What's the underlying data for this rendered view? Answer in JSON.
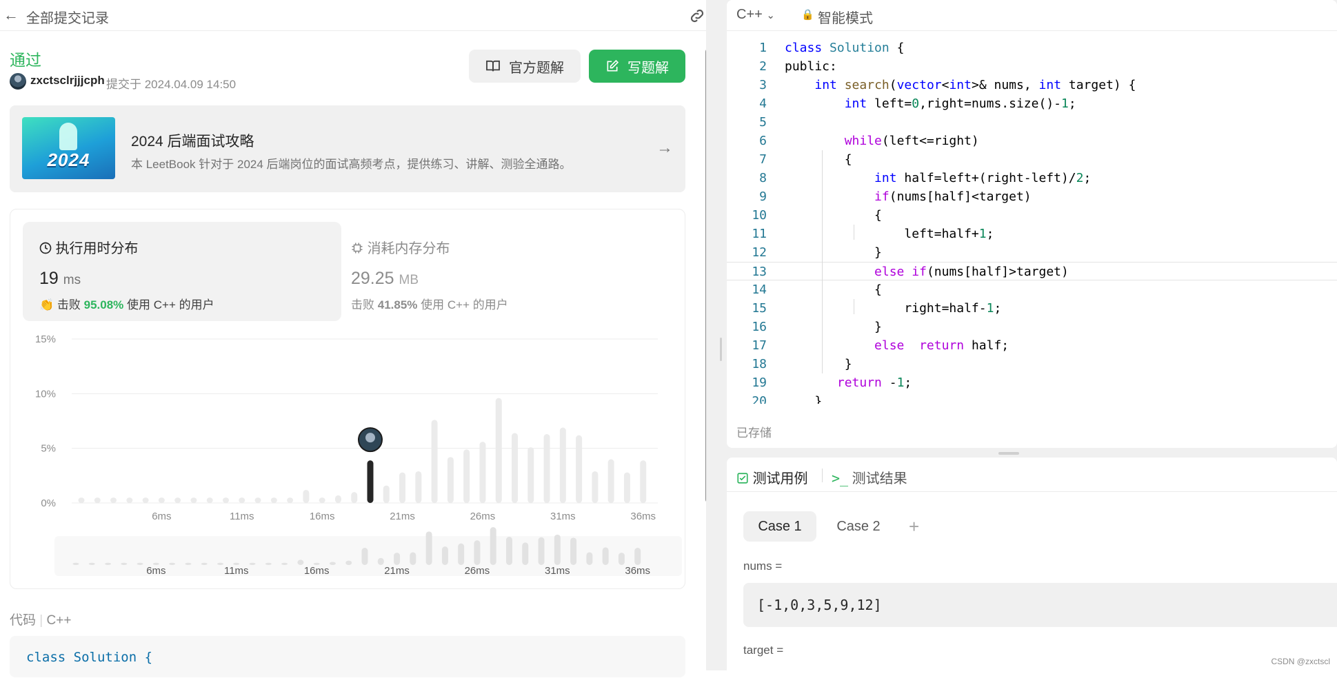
{
  "top": {
    "back_label": "全部提交记录"
  },
  "submission": {
    "status": "通过",
    "user": "zxctsclrjjjcph",
    "submitted_at": "提交于 2024.04.09 14:50",
    "official_solution": "官方题解",
    "write_solution": "写题解"
  },
  "banner": {
    "image_text": "2024",
    "title": "2024 后端面试攻略",
    "desc": "本 LeetBook 针对于 2024 后端岗位的面试高频考点，提供练习、讲解、测验全通路。"
  },
  "runtime": {
    "title": "执行用时分布",
    "value": "19",
    "unit": "ms",
    "beat_prefix": "击败",
    "beat_pct": "95.08%",
    "beat_suffix": "使用 C++ 的用户"
  },
  "memory": {
    "title": "消耗内存分布",
    "value": "29.25",
    "unit": "MB",
    "beat_prefix": "击败",
    "beat_pct": "41.85%",
    "beat_suffix": "使用 C++ 的用户"
  },
  "chart_data": {
    "type": "bar",
    "y_ticks": [
      "15%",
      "10%",
      "5%",
      "0%"
    ],
    "x_ticks": [
      "6ms",
      "11ms",
      "16ms",
      "21ms",
      "26ms",
      "31ms",
      "36ms"
    ],
    "ylim": [
      0,
      15
    ],
    "highlight": "19ms",
    "categories": [
      "1ms",
      "2ms",
      "3ms",
      "4ms",
      "5ms",
      "6ms",
      "7ms",
      "8ms",
      "9ms",
      "10ms",
      "11ms",
      "12ms",
      "13ms",
      "14ms",
      "15ms",
      "16ms",
      "17ms",
      "18ms",
      "19ms",
      "20ms",
      "21ms",
      "22ms",
      "23ms",
      "24ms",
      "25ms",
      "26ms",
      "27ms",
      "28ms",
      "29ms",
      "30ms",
      "31ms",
      "32ms",
      "33ms",
      "34ms",
      "35ms",
      "36ms",
      "37ms"
    ],
    "values": [
      0.5,
      0.5,
      0.5,
      0.5,
      0.5,
      0.5,
      0.5,
      0.5,
      0.5,
      0.5,
      0.5,
      0.5,
      0.5,
      0.5,
      1.2,
      0.5,
      0.7,
      1.0,
      3.9,
      1.6,
      2.8,
      2.9,
      7.6,
      4.2,
      4.9,
      5.6,
      9.6,
      6.4,
      5.1,
      6.3,
      6.9,
      6.2,
      2.9,
      4.0,
      2.8,
      3.9,
      0
    ]
  },
  "code_section": {
    "label": "代码",
    "lang": "C++",
    "preview": "class Solution {"
  },
  "editor": {
    "lang": "C++",
    "mode": "智能模式",
    "saved": "已存储",
    "lines": [
      "class Solution {",
      "public:",
      "    int search(vector<int>& nums, int target) {",
      "        int left=0,right=nums.size()-1;",
      "",
      "        while(left<=right)",
      "        {",
      "            int half=left+(right-left)/2;",
      "            if(nums[half]<target)",
      "            {",
      "                left=half+1;",
      "            }",
      "            else if(nums[half]>target)",
      "            {",
      "                right=half-1;",
      "            }",
      "            else  return half;",
      "        }",
      "       return -1;",
      "    }"
    ]
  },
  "tests": {
    "tab_cases": "测试用例",
    "tab_result": "测试结果",
    "cases": [
      "Case 1",
      "Case 2"
    ],
    "nums_label": "nums =",
    "nums_value": "[-1,0,3,5,9,12]",
    "target_label": "target ="
  },
  "watermark": "CSDN @zxctscl"
}
